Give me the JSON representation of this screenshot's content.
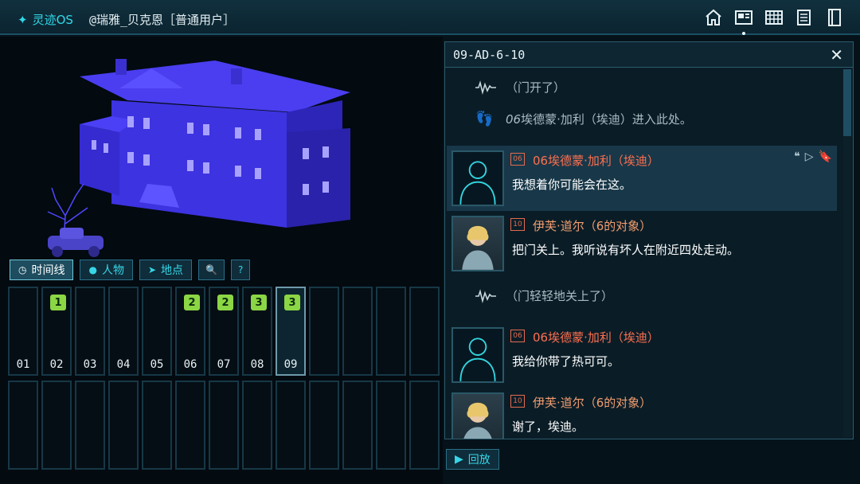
{
  "topbar": {
    "os_name": "灵迹OS",
    "user": "@瑞雅_贝克恩［普通用户］",
    "icons": [
      "home-icon",
      "window-icon",
      "grid-icon",
      "notes-icon",
      "book-icon"
    ]
  },
  "tabs": [
    {
      "icon": "clock-icon",
      "label": "时间线"
    },
    {
      "icon": "person-icon",
      "label": "人物"
    },
    {
      "icon": "location-icon",
      "label": "地点"
    },
    {
      "icon": "search-icon",
      "label": ""
    },
    {
      "icon": "help-icon",
      "label": ""
    }
  ],
  "timeline": {
    "cells": [
      {
        "num": "01",
        "badge": ""
      },
      {
        "num": "02",
        "badge": "1"
      },
      {
        "num": "03",
        "badge": ""
      },
      {
        "num": "04",
        "badge": ""
      },
      {
        "num": "05",
        "badge": ""
      },
      {
        "num": "06",
        "badge": "2"
      },
      {
        "num": "07",
        "badge": "2"
      },
      {
        "num": "08",
        "badge": "3"
      },
      {
        "num": "09",
        "badge": "3"
      }
    ]
  },
  "panel": {
    "title": "09-AD-6-10",
    "sys1": "（门开了）",
    "sys2_prefix": "06",
    "sys2": "埃德蒙·加利（埃迪）进入此处。",
    "sys3": "（门轻轻地关上了）",
    "messages": [
      {
        "id": "06",
        "name": "06埃德蒙·加利（埃迪）",
        "text": "我想着你可能会在这。"
      },
      {
        "id": "10",
        "name": "伊芙·道尔（6的对象）",
        "text": "把门关上。我听说有坏人在附近四处走动。"
      },
      {
        "id": "06",
        "name": "06埃德蒙·加利（埃迪）",
        "text": "我给你带了热可可。"
      },
      {
        "id": "10",
        "name": "伊芙·道尔（6的对象）",
        "text": "谢了，埃迪。"
      }
    ]
  },
  "replay_label": "回放",
  "colors": {
    "accent": "#2fd9e8",
    "badge": "#8bd644",
    "name_red": "#ff6f4f"
  }
}
